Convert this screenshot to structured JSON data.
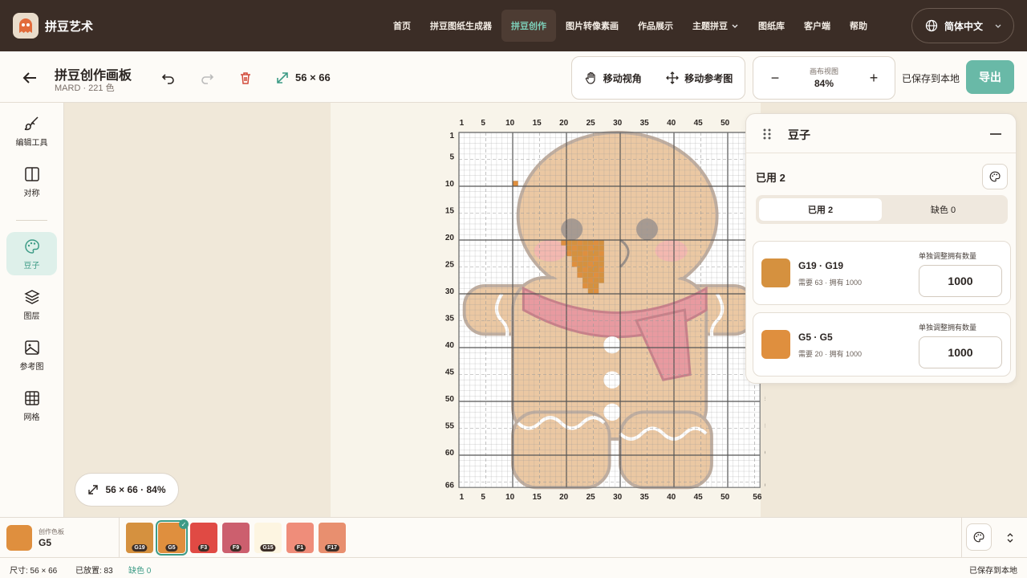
{
  "nav": {
    "brand": "拼豆艺术",
    "items": [
      {
        "label": "首页",
        "active": false
      },
      {
        "label": "拼豆图纸生成器",
        "active": false
      },
      {
        "label": "拼豆创作",
        "active": true
      },
      {
        "label": "图片转像素画",
        "active": false
      },
      {
        "label": "作品展示",
        "active": false
      },
      {
        "label": "主题拼豆",
        "active": false,
        "dropdown": true
      },
      {
        "label": "图纸库",
        "active": false
      },
      {
        "label": "客户端",
        "active": false
      },
      {
        "label": "帮助",
        "active": false
      }
    ],
    "language": "简体中文"
  },
  "toolbar": {
    "title": "拼豆创作画板",
    "subtitle": "MARD · 221 色",
    "size": "56 × 66",
    "move_view": "移动视角",
    "move_ref": "移动参考图",
    "zoom_caption": "画布视图",
    "zoom_value": "84%",
    "saved": "已保存到本地",
    "export": "导出"
  },
  "sidebar": {
    "items": [
      {
        "label": "编辑工具",
        "icon": "brush-icon"
      },
      {
        "label": "对称",
        "icon": "symmetry-icon"
      },
      {
        "label": "豆子",
        "icon": "palette-icon",
        "active": true
      },
      {
        "label": "图层",
        "icon": "layers-icon"
      },
      {
        "label": "参考图",
        "icon": "image-icon"
      },
      {
        "label": "网格",
        "icon": "grid-icon"
      }
    ]
  },
  "canvas": {
    "cols": 56,
    "rows": 66,
    "col_ticks": [
      "1",
      "5",
      "10",
      "15",
      "20",
      "25",
      "30",
      "35",
      "40",
      "45",
      "50",
      "56"
    ],
    "row_ticks": [
      "1",
      "5",
      "10",
      "15",
      "20",
      "25",
      "30",
      "35",
      "40",
      "45",
      "50",
      "55",
      "60",
      "66"
    ],
    "zoom_pill": "56 × 66 · 84%"
  },
  "beads_panel": {
    "title": "豆子",
    "used_title": "已用 2",
    "tab_used": "已用 2",
    "tab_missing": "缺色 0",
    "adjust_label": "单独调整拥有数量",
    "items": [
      {
        "name": "G19 · G19",
        "need": "需要 63 · 拥有 1000",
        "qty": "1000",
        "color": "#d5913f"
      },
      {
        "name": "G5 · G5",
        "need": "需要 20 · 拥有 1000",
        "qty": "1000",
        "color": "#df8f3e"
      }
    ]
  },
  "palette": {
    "current_caption": "创作色板",
    "current_value": "G5",
    "swatches": [
      {
        "code": "G19",
        "color": "#d5913f",
        "selected": false
      },
      {
        "code": "G5",
        "color": "#df8f3e",
        "selected": true
      },
      {
        "code": "F3",
        "color": "#e04a44",
        "selected": false
      },
      {
        "code": "F9",
        "color": "#cc5f6e",
        "selected": false
      },
      {
        "code": "G15",
        "color": "#fdf5e1",
        "selected": false
      },
      {
        "code": "F1",
        "color": "#ef8d7a",
        "selected": false
      },
      {
        "code": "F17",
        "color": "#e88f6f",
        "selected": false
      }
    ]
  },
  "status": {
    "size": "尺寸: 56 × 66",
    "placed": "已放置: 83",
    "missing": "缺色 0",
    "saved": "已保存到本地"
  }
}
